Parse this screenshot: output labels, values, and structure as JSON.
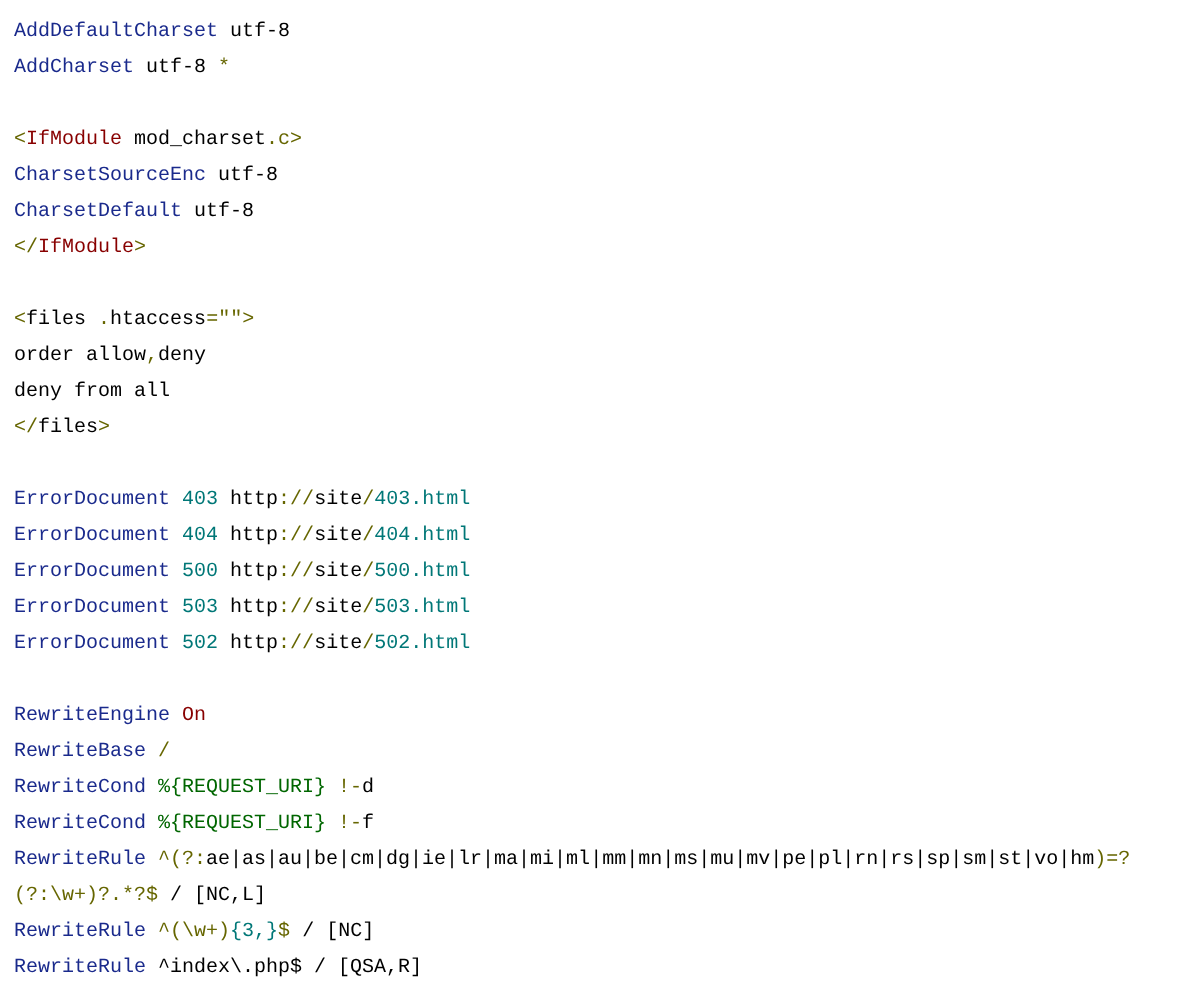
{
  "code_blocks": [
    {
      "lines": [
        [
          {
            "kind": "directive",
            "text": "AddDefaultCharset"
          },
          {
            "kind": "plain",
            "text": " utf-8"
          }
        ],
        [
          {
            "kind": "directive",
            "text": "AddCharset"
          },
          {
            "kind": "plain",
            "text": " utf-8 "
          },
          {
            "kind": "punct",
            "text": "*"
          }
        ]
      ]
    },
    {
      "lines": [
        [
          {
            "kind": "punct",
            "text": "<"
          },
          {
            "kind": "tag",
            "text": "IfModule"
          },
          {
            "kind": "plain",
            "text": " mod_charset"
          },
          {
            "kind": "punct",
            "text": ".c>"
          }
        ],
        [
          {
            "kind": "directive",
            "text": "CharsetSourceEnc"
          },
          {
            "kind": "plain",
            "text": " utf-8"
          }
        ],
        [
          {
            "kind": "directive",
            "text": "CharsetDefault"
          },
          {
            "kind": "plain",
            "text": " utf-8"
          }
        ],
        [
          {
            "kind": "punct",
            "text": "</"
          },
          {
            "kind": "tag",
            "text": "IfModule"
          },
          {
            "kind": "punct",
            "text": ">"
          }
        ]
      ]
    },
    {
      "lines": [
        [
          {
            "kind": "punct",
            "text": "<"
          },
          {
            "kind": "plain",
            "text": "files "
          },
          {
            "kind": "punct",
            "text": "."
          },
          {
            "kind": "plain",
            "text": "htaccess"
          },
          {
            "kind": "punct",
            "text": "=\"\">"
          }
        ],
        [
          {
            "kind": "plain",
            "text": "order allow"
          },
          {
            "kind": "punct",
            "text": ","
          },
          {
            "kind": "plain",
            "text": "deny"
          }
        ],
        [
          {
            "kind": "plain",
            "text": "deny from all"
          }
        ],
        [
          {
            "kind": "punct",
            "text": "</"
          },
          {
            "kind": "plain",
            "text": "files"
          },
          {
            "kind": "punct",
            "text": ">"
          }
        ]
      ]
    },
    {
      "lines": [
        [
          {
            "kind": "directive",
            "text": "ErrorDocument"
          },
          {
            "kind": "number",
            "text": " 403"
          },
          {
            "kind": "plain",
            "text": " http"
          },
          {
            "kind": "punct",
            "text": "://"
          },
          {
            "kind": "plain",
            "text": "site"
          },
          {
            "kind": "punct",
            "text": "/"
          },
          {
            "kind": "number",
            "text": "403.html"
          }
        ],
        [
          {
            "kind": "directive",
            "text": "ErrorDocument"
          },
          {
            "kind": "number",
            "text": " 404"
          },
          {
            "kind": "plain",
            "text": " http"
          },
          {
            "kind": "punct",
            "text": "://"
          },
          {
            "kind": "plain",
            "text": "site"
          },
          {
            "kind": "punct",
            "text": "/"
          },
          {
            "kind": "number",
            "text": "404.html"
          }
        ],
        [
          {
            "kind": "directive",
            "text": "ErrorDocument"
          },
          {
            "kind": "number",
            "text": " 500"
          },
          {
            "kind": "plain",
            "text": " http"
          },
          {
            "kind": "punct",
            "text": "://"
          },
          {
            "kind": "plain",
            "text": "site"
          },
          {
            "kind": "punct",
            "text": "/"
          },
          {
            "kind": "number",
            "text": "500.html"
          }
        ],
        [
          {
            "kind": "directive",
            "text": "ErrorDocument"
          },
          {
            "kind": "number",
            "text": " 503"
          },
          {
            "kind": "plain",
            "text": " http"
          },
          {
            "kind": "punct",
            "text": "://"
          },
          {
            "kind": "plain",
            "text": "site"
          },
          {
            "kind": "punct",
            "text": "/"
          },
          {
            "kind": "number",
            "text": "503.html"
          }
        ],
        [
          {
            "kind": "directive",
            "text": "ErrorDocument"
          },
          {
            "kind": "number",
            "text": " 502"
          },
          {
            "kind": "plain",
            "text": " http"
          },
          {
            "kind": "punct",
            "text": "://"
          },
          {
            "kind": "plain",
            "text": "site"
          },
          {
            "kind": "punct",
            "text": "/"
          },
          {
            "kind": "number",
            "text": "502.html"
          }
        ]
      ]
    },
    {
      "lines": [
        [
          {
            "kind": "directive",
            "text": "RewriteEngine"
          },
          {
            "kind": "tag",
            "text": " On"
          }
        ],
        [
          {
            "kind": "directive",
            "text": "RewriteBase"
          },
          {
            "kind": "punct",
            "text": " /"
          }
        ],
        [
          {
            "kind": "directive",
            "text": "RewriteCond"
          },
          {
            "kind": "string",
            "text": " %{REQUEST_URI}"
          },
          {
            "kind": "punct",
            "text": " !-"
          },
          {
            "kind": "plain",
            "text": "d"
          }
        ],
        [
          {
            "kind": "directive",
            "text": "RewriteCond"
          },
          {
            "kind": "string",
            "text": " %{REQUEST_URI}"
          },
          {
            "kind": "punct",
            "text": " !-"
          },
          {
            "kind": "plain",
            "text": "f"
          }
        ],
        [
          {
            "kind": "directive",
            "text": "RewriteRule"
          },
          {
            "kind": "punct",
            "text": " ^(?:"
          },
          {
            "kind": "plain",
            "text": "ae|as|au|be|cm|dg|ie|lr|ma|mi|ml|mm|mn|ms|mu|mv|pe|pl|rn|rs|sp|sm|st|vo|hm"
          },
          {
            "kind": "punct",
            "text": ")=?"
          }
        ],
        [
          {
            "kind": "punct",
            "text": "(?:\\w+)?.*?$"
          },
          {
            "kind": "plain",
            "text": " / [NC,L]"
          }
        ],
        [
          {
            "kind": "directive",
            "text": "RewriteRule"
          },
          {
            "kind": "punct",
            "text": " ^(\\w+)"
          },
          {
            "kind": "number",
            "text": "{3,}"
          },
          {
            "kind": "punct",
            "text": "$"
          },
          {
            "kind": "plain",
            "text": " / [NC]"
          }
        ],
        [
          {
            "kind": "directive",
            "text": "RewriteRule"
          },
          {
            "kind": "plain",
            "text": " ^index\\.php$ / [QSA,R]"
          }
        ]
      ]
    }
  ]
}
